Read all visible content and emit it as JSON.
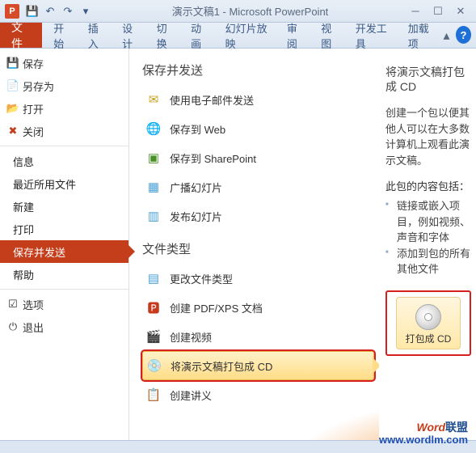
{
  "title": "演示文稿1 - Microsoft PowerPoint",
  "qat": {
    "save": "💾",
    "undo": "↶",
    "redo": "↷",
    "more": "▾"
  },
  "win": {
    "min": "─",
    "max": "☐",
    "close": "✕",
    "upcaret": "▴"
  },
  "tabs": {
    "file": "文件",
    "home": "开始",
    "insert": "插入",
    "design": "设计",
    "transitions": "切换",
    "animations": "动画",
    "slideshow": "幻灯片放映",
    "review": "审阅",
    "view": "视图",
    "developer": "开发工具",
    "addins": "加载项"
  },
  "nav": {
    "save": "保存",
    "saveas": "另存为",
    "open": "打开",
    "close": "关闭",
    "info": "信息",
    "recent": "最近所用文件",
    "new": "新建",
    "print": "打印",
    "saveandsend": "保存并发送",
    "help": "帮助",
    "options": "选项",
    "exit": "退出"
  },
  "mid": {
    "section1": "保存并发送",
    "opts1": {
      "email": "使用电子邮件发送",
      "web": "保存到 Web",
      "sharepoint": "保存到 SharePoint",
      "broadcast": "广播幻灯片",
      "publish": "发布幻灯片"
    },
    "section2": "文件类型",
    "opts2": {
      "changetype": "更改文件类型",
      "pdf": "创建 PDF/XPS 文档",
      "video": "创建视频",
      "cd": "将演示文稿打包成 CD",
      "handouts": "创建讲义"
    }
  },
  "right": {
    "title": "将演示文稿打包成 CD",
    "desc": "创建一个包以便其他人可以在大多数计算机上观看此演示文稿。",
    "list_label": "此包的内容包括：",
    "b1": "链接或嵌入项目，例如视频、声音和字体",
    "b2": "添加到包的所有其他文件",
    "action": "打包成 CD"
  },
  "watermark": {
    "brand_en": "Word",
    "brand_cn": "联盟",
    "url": "www.wordlm.com"
  }
}
